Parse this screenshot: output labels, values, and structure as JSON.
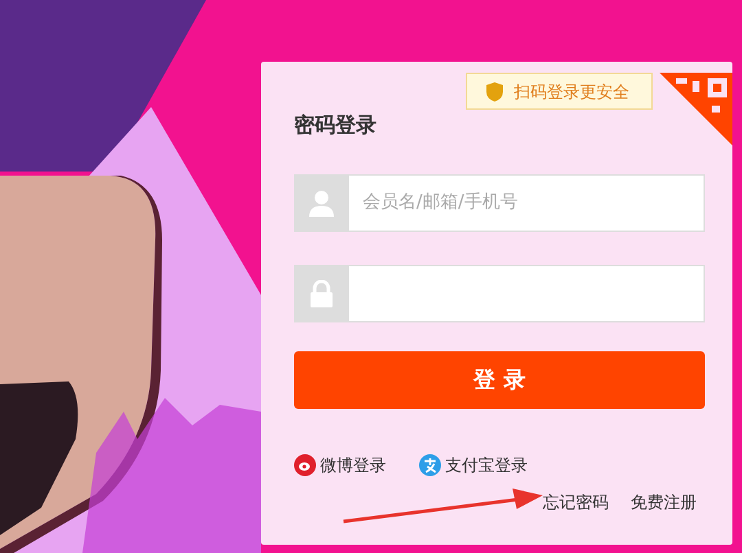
{
  "qr_tip": {
    "text": "扫码登录更安全"
  },
  "title": "密码登录",
  "fields": [
    {
      "kind": "user",
      "placeholder": "会员名/邮箱/手机号"
    },
    {
      "kind": "password"
    }
  ],
  "login_button": "登 录",
  "social_logins": [
    {
      "kind": "weibo",
      "label": "微博登录"
    },
    {
      "kind": "alipay",
      "label": "支付宝登录"
    }
  ],
  "links": [
    "忘记密码",
    "免费注册"
  ]
}
